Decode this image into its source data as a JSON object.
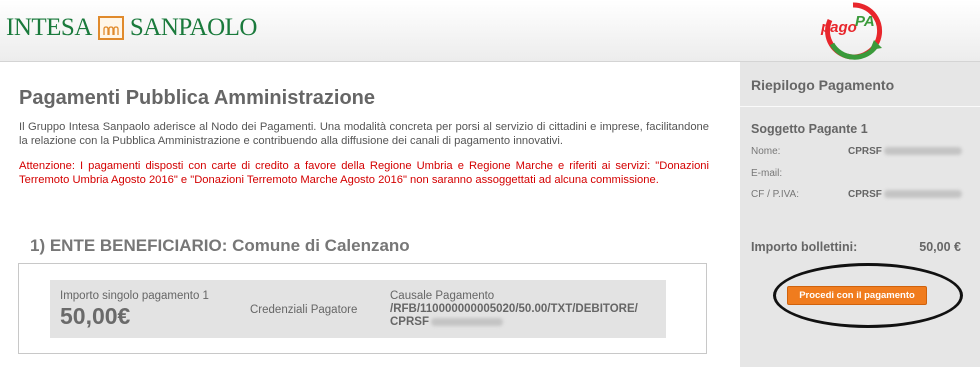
{
  "header": {
    "brand_left": "INTESA",
    "brand_right": "SANPAOLO",
    "pagopa_logo": {
      "text_main": "pago",
      "text_accent": "PA"
    }
  },
  "main": {
    "title": "Pagamenti Pubblica Amministrazione",
    "intro": "Il Gruppo Intesa Sanpaolo aderisce al Nodo dei Pagamenti. Una modalità concreta per porsi al servizio di cittadini e imprese, facilitandone la relazione con la Pubblica Amministrazione e contribuendo alla diffusione dei canali di pagamento innovativi.",
    "warning": "Attenzione: I pagamenti disposti con carte di credito a favore della Regione Umbria e Regione Marche e riferiti ai servizi: \"Donazioni Terremoto Umbria Agosto 2016\" e \"Donazioni Terremoto Marche Agosto 2016\" non saranno assoggettati ad alcuna commissione.",
    "section_title": "1) ENTE BENEFICIARIO: Comune di Calenzano",
    "payment": {
      "amount_label": "Importo singolo pagamento 1",
      "amount_value": "50,00€",
      "credentials_label": "Credenziali Pagatore",
      "causale_label": "Causale Pagamento",
      "causale_line1": "/RFB/110000000005020/50.00/TXT/DEBITORE/",
      "causale_line2": "CPRSF"
    }
  },
  "sidebar": {
    "title": "Riepilogo Pagamento",
    "subject_title": "Soggetto Pagante 1",
    "fields": {
      "nome_label": "Nome:",
      "nome_value": "CPRSF",
      "email_label": "E-mail:",
      "email_value": "",
      "cf_label": "CF / P.IVA:",
      "cf_value": "CPRSF"
    },
    "total_label": "Importo bollettini:",
    "total_value": "50,00 €",
    "proceed_button": "Procedi con il pagamento"
  },
  "colors": {
    "brand_green": "#1a7a3c",
    "warning_red": "#d40000",
    "button_orange": "#f07c1e",
    "sidebar_bg": "#e6e6e6",
    "pagopa_red": "#e8262c",
    "pagopa_green": "#3a9a3a"
  }
}
